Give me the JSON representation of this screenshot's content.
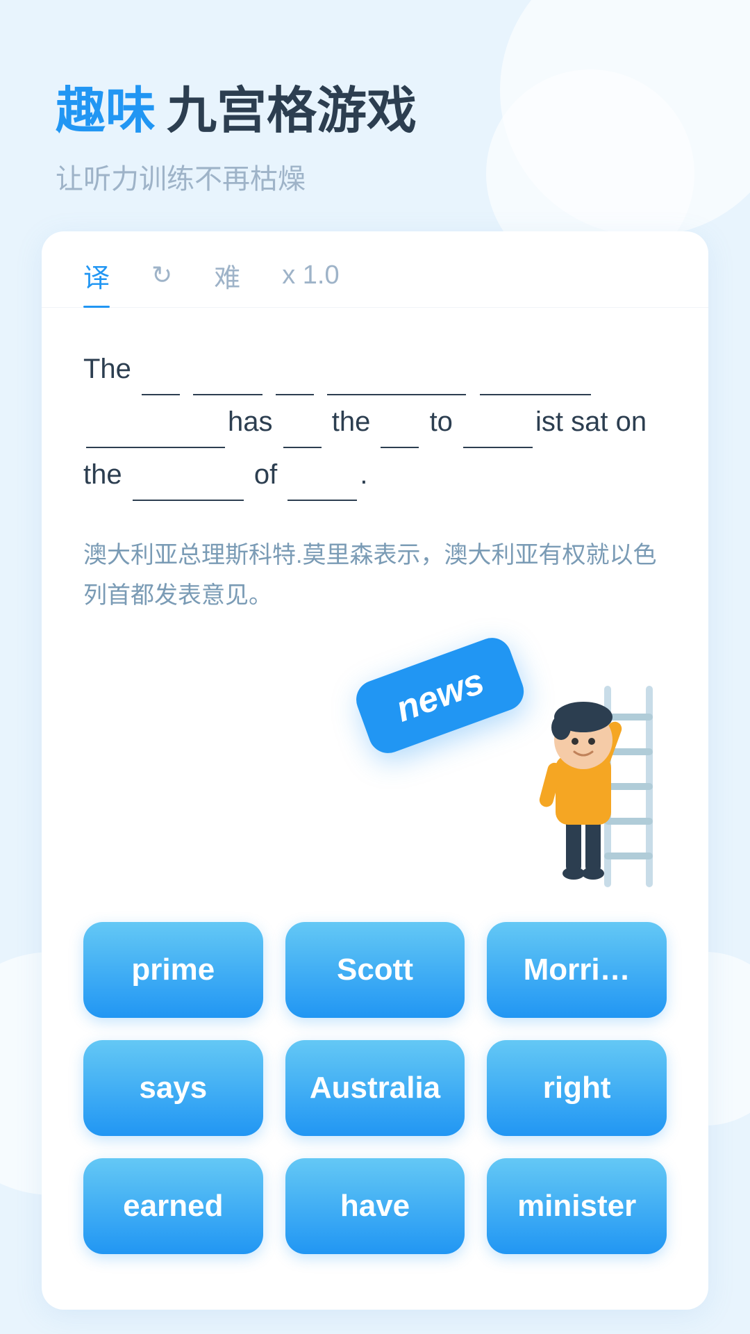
{
  "header": {
    "title_blue": "趣味",
    "title_dark": "九宫格游戏",
    "subtitle": "让听力训练不再枯燥"
  },
  "tabs": [
    {
      "id": "translate",
      "label": "译",
      "active": true
    },
    {
      "id": "refresh",
      "label": "↻",
      "active": false
    },
    {
      "id": "difficulty",
      "label": "难",
      "active": false
    },
    {
      "id": "speed",
      "label": "x 1.0",
      "active": false
    }
  ],
  "sentence": {
    "line1": "The ___ _______ ___ __________ _____",
    "line2": "________ has ___ the ___ to _____ ist",
    "line3": "sat on the _____ of _____.",
    "display": "The ___ ______ ___ _________ _____ _______ has ___ the ___ to ___ist sat on the _____ of _____."
  },
  "translation": "澳大利亚总理斯科特.莫里森表示，澳大利亚有权就以色列首都发表意见。",
  "floating_word": "news",
  "word_buttons": [
    {
      "id": "prime",
      "label": "prime"
    },
    {
      "id": "scott",
      "label": "Scott"
    },
    {
      "id": "morrison",
      "label": "Morri…"
    },
    {
      "id": "says",
      "label": "says"
    },
    {
      "id": "australia",
      "label": "Australia"
    },
    {
      "id": "right",
      "label": "right"
    },
    {
      "id": "earned",
      "label": "earned"
    },
    {
      "id": "have",
      "label": "have"
    },
    {
      "id": "minister",
      "label": "minister"
    }
  ]
}
